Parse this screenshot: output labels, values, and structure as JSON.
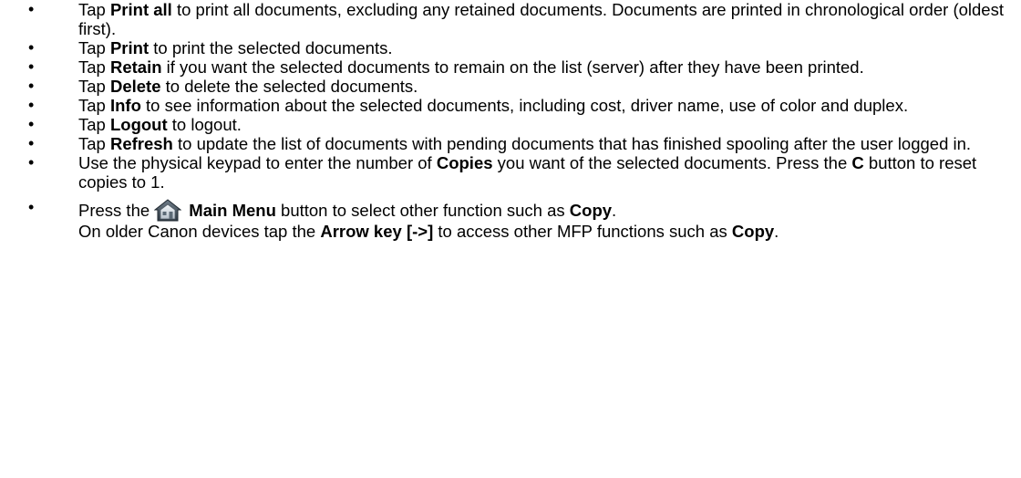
{
  "items": [
    {
      "pre": "Tap ",
      "bold": "Print all",
      "post": " to print all documents, excluding any retained documents. Documents are printed in chronological order (oldest first)."
    },
    {
      "pre": "Tap ",
      "bold": "Print",
      "post": " to print the selected documents."
    },
    {
      "pre": "Tap ",
      "bold": "Retain",
      "post": " if you want the selected documents to remain on the list (server) after they have been printed."
    },
    {
      "pre": "Tap ",
      "bold": "Delete",
      "post": " to delete the selected documents."
    },
    {
      "pre": "Tap ",
      "bold": "Info",
      "post": " to see information about the selected documents, including cost, driver name, use of color and duplex."
    },
    {
      "pre": "Tap ",
      "bold": "Logout",
      "post": " to logout."
    },
    {
      "pre": "Tap ",
      "bold": "Refresh",
      "post": " to update the list of documents with pending documents that has finished spooling after the user logged in."
    },
    {
      "pre": "Use the physical keypad to enter the number of ",
      "bold": "Copies",
      "post": " you want of the selected documents. Press the ",
      "bold2": "C",
      "post2": " button to reset copies to 1."
    }
  ],
  "main_menu_item": {
    "pre": "Press the ",
    "icon": "home-icon",
    "bold": "Main Menu",
    "post": " button to select other function such as ",
    "bold2": "Copy",
    "post2": ".",
    "line2_pre": "On older Canon devices tap the ",
    "line2_bold": "Arrow key [->]",
    "line2_post": " to access other MFP functions such as ",
    "line2_bold2": "Copy",
    "line2_post2": "."
  },
  "bullet_char": "•"
}
